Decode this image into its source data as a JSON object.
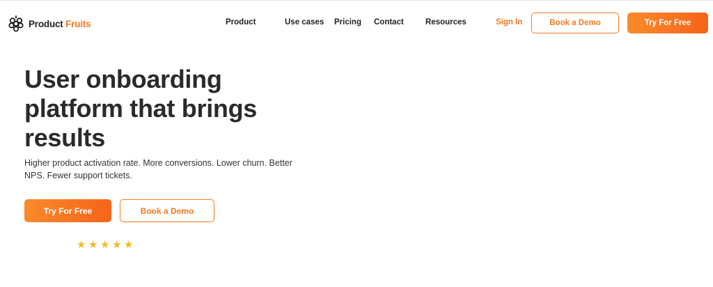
{
  "header": {
    "logo": {
      "word1": "Product",
      "word2": "Fruits"
    },
    "nav": [
      {
        "label": "Product"
      },
      {
        "label": "Use cases"
      },
      {
        "label": "Pricing"
      },
      {
        "label": "Contact"
      },
      {
        "label": "Resources"
      }
    ],
    "signin_label": "Sign In",
    "demo_label": "Book a Demo",
    "try_label": "Try For Free"
  },
  "hero": {
    "headline_line1": "User onboarding",
    "headline_line2": "platform that brings",
    "headline_line3": "results",
    "subtext": "Higher product activation rate. More conversions. Lower churn. Better NPS. Fewer support tickets.",
    "try_label": "Try For Free",
    "demo_label": "Book a Demo",
    "rating": {
      "stars": 5,
      "max": 5
    }
  },
  "colors": {
    "accent": "#f7781e",
    "star": "#f6b81c",
    "text": "#2a2a2a"
  },
  "icons": {
    "logo": "grapes-icon",
    "rating": "star-icon"
  }
}
